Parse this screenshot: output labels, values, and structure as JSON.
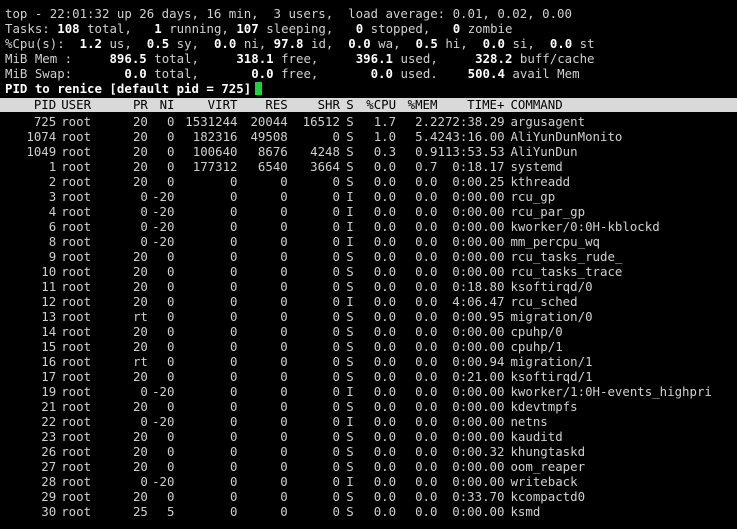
{
  "summary": {
    "line1": "top - 22:01:32 up 26 days, 16 min,  3 users,  load average: 0.01, 0.02, 0.00",
    "tasks": {
      "label": "Tasks:",
      "total": "108",
      "total_l": "total,",
      "running": "1",
      "running_l": "running,",
      "sleeping": "107",
      "sleeping_l": "sleeping,",
      "stopped": "0",
      "stopped_l": "stopped,",
      "zombie": "0",
      "zombie_l": "zombie"
    },
    "cpu": {
      "label": "%Cpu(s):",
      "us": "1.2",
      "us_l": "us,",
      "sy": "0.5",
      "sy_l": "sy,",
      "ni": "0.0",
      "ni_l": "ni,",
      "id": "97.8",
      "id_l": "id,",
      "wa": "0.0",
      "wa_l": "wa,",
      "hi": "0.5",
      "hi_l": "hi,",
      "si": "0.0",
      "si_l": "si,",
      "st": "0.0",
      "st_l": "st"
    },
    "mem": {
      "label": "MiB Mem :",
      "total": "896.5",
      "total_l": "total,",
      "free": "318.1",
      "free_l": "free,",
      "used": "396.1",
      "used_l": "used,",
      "buff": "328.2",
      "buff_l": "buff/cache"
    },
    "swap": {
      "label": "MiB Swap:",
      "total": "0.0",
      "total_l": "total,",
      "free": "0.0",
      "free_l": "free,",
      "used": "0.0",
      "used_l": "used.",
      "avail": "500.4",
      "avail_l": "avail Mem"
    }
  },
  "prompt": {
    "text": "PID to renice [default pid = 725]"
  },
  "columns": {
    "pid": "PID",
    "user": "USER",
    "pr": "PR",
    "ni": "NI",
    "virt": "VIRT",
    "res": "RES",
    "shr": "SHR",
    "s": "S",
    "cpu": "%CPU",
    "mem": "%MEM",
    "time": "TIME+",
    "command": "COMMAND"
  },
  "processes": [
    {
      "pid": "725",
      "user": "root",
      "pr": "20",
      "ni": "0",
      "virt": "1531244",
      "res": "20044",
      "shr": "16512",
      "s": "S",
      "cpu": "1.7",
      "mem": "2.2",
      "time": "272:38.29",
      "command": "argusagent"
    },
    {
      "pid": "1074",
      "user": "root",
      "pr": "20",
      "ni": "0",
      "virt": "182316",
      "res": "49508",
      "shr": "0",
      "s": "S",
      "cpu": "1.0",
      "mem": "5.4",
      "time": "243:16.00",
      "command": "AliYunDunMonito"
    },
    {
      "pid": "1049",
      "user": "root",
      "pr": "20",
      "ni": "0",
      "virt": "100640",
      "res": "8676",
      "shr": "4248",
      "s": "S",
      "cpu": "0.3",
      "mem": "0.9",
      "time": "113:53.53",
      "command": "AliYunDun"
    },
    {
      "pid": "1",
      "user": "root",
      "pr": "20",
      "ni": "0",
      "virt": "177312",
      "res": "6540",
      "shr": "3664",
      "s": "S",
      "cpu": "0.0",
      "mem": "0.7",
      "time": "0:18.17",
      "command": "systemd"
    },
    {
      "pid": "2",
      "user": "root",
      "pr": "20",
      "ni": "0",
      "virt": "0",
      "res": "0",
      "shr": "0",
      "s": "S",
      "cpu": "0.0",
      "mem": "0.0",
      "time": "0:00.25",
      "command": "kthreadd"
    },
    {
      "pid": "3",
      "user": "root",
      "pr": "0",
      "ni": "-20",
      "virt": "0",
      "res": "0",
      "shr": "0",
      "s": "I",
      "cpu": "0.0",
      "mem": "0.0",
      "time": "0:00.00",
      "command": "rcu_gp"
    },
    {
      "pid": "4",
      "user": "root",
      "pr": "0",
      "ni": "-20",
      "virt": "0",
      "res": "0",
      "shr": "0",
      "s": "I",
      "cpu": "0.0",
      "mem": "0.0",
      "time": "0:00.00",
      "command": "rcu_par_gp"
    },
    {
      "pid": "6",
      "user": "root",
      "pr": "0",
      "ni": "-20",
      "virt": "0",
      "res": "0",
      "shr": "0",
      "s": "I",
      "cpu": "0.0",
      "mem": "0.0",
      "time": "0:00.00",
      "command": "kworker/0:0H-kblockd"
    },
    {
      "pid": "8",
      "user": "root",
      "pr": "0",
      "ni": "-20",
      "virt": "0",
      "res": "0",
      "shr": "0",
      "s": "I",
      "cpu": "0.0",
      "mem": "0.0",
      "time": "0:00.00",
      "command": "mm_percpu_wq"
    },
    {
      "pid": "9",
      "user": "root",
      "pr": "20",
      "ni": "0",
      "virt": "0",
      "res": "0",
      "shr": "0",
      "s": "S",
      "cpu": "0.0",
      "mem": "0.0",
      "time": "0:00.00",
      "command": "rcu_tasks_rude_"
    },
    {
      "pid": "10",
      "user": "root",
      "pr": "20",
      "ni": "0",
      "virt": "0",
      "res": "0",
      "shr": "0",
      "s": "S",
      "cpu": "0.0",
      "mem": "0.0",
      "time": "0:00.00",
      "command": "rcu_tasks_trace"
    },
    {
      "pid": "11",
      "user": "root",
      "pr": "20",
      "ni": "0",
      "virt": "0",
      "res": "0",
      "shr": "0",
      "s": "S",
      "cpu": "0.0",
      "mem": "0.0",
      "time": "0:18.80",
      "command": "ksoftirqd/0"
    },
    {
      "pid": "12",
      "user": "root",
      "pr": "20",
      "ni": "0",
      "virt": "0",
      "res": "0",
      "shr": "0",
      "s": "I",
      "cpu": "0.0",
      "mem": "0.0",
      "time": "4:06.47",
      "command": "rcu_sched"
    },
    {
      "pid": "13",
      "user": "root",
      "pr": "rt",
      "ni": "0",
      "virt": "0",
      "res": "0",
      "shr": "0",
      "s": "S",
      "cpu": "0.0",
      "mem": "0.0",
      "time": "0:00.95",
      "command": "migration/0"
    },
    {
      "pid": "14",
      "user": "root",
      "pr": "20",
      "ni": "0",
      "virt": "0",
      "res": "0",
      "shr": "0",
      "s": "S",
      "cpu": "0.0",
      "mem": "0.0",
      "time": "0:00.00",
      "command": "cpuhp/0"
    },
    {
      "pid": "15",
      "user": "root",
      "pr": "20",
      "ni": "0",
      "virt": "0",
      "res": "0",
      "shr": "0",
      "s": "S",
      "cpu": "0.0",
      "mem": "0.0",
      "time": "0:00.00",
      "command": "cpuhp/1"
    },
    {
      "pid": "16",
      "user": "root",
      "pr": "rt",
      "ni": "0",
      "virt": "0",
      "res": "0",
      "shr": "0",
      "s": "S",
      "cpu": "0.0",
      "mem": "0.0",
      "time": "0:00.94",
      "command": "migration/1"
    },
    {
      "pid": "17",
      "user": "root",
      "pr": "20",
      "ni": "0",
      "virt": "0",
      "res": "0",
      "shr": "0",
      "s": "S",
      "cpu": "0.0",
      "mem": "0.0",
      "time": "0:21.00",
      "command": "ksoftirqd/1"
    },
    {
      "pid": "19",
      "user": "root",
      "pr": "0",
      "ni": "-20",
      "virt": "0",
      "res": "0",
      "shr": "0",
      "s": "I",
      "cpu": "0.0",
      "mem": "0.0",
      "time": "0:00.00",
      "command": "kworker/1:0H-events_highpri"
    },
    {
      "pid": "21",
      "user": "root",
      "pr": "20",
      "ni": "0",
      "virt": "0",
      "res": "0",
      "shr": "0",
      "s": "S",
      "cpu": "0.0",
      "mem": "0.0",
      "time": "0:00.00",
      "command": "kdevtmpfs"
    },
    {
      "pid": "22",
      "user": "root",
      "pr": "0",
      "ni": "-20",
      "virt": "0",
      "res": "0",
      "shr": "0",
      "s": "I",
      "cpu": "0.0",
      "mem": "0.0",
      "time": "0:00.00",
      "command": "netns"
    },
    {
      "pid": "23",
      "user": "root",
      "pr": "20",
      "ni": "0",
      "virt": "0",
      "res": "0",
      "shr": "0",
      "s": "S",
      "cpu": "0.0",
      "mem": "0.0",
      "time": "0:00.00",
      "command": "kauditd"
    },
    {
      "pid": "26",
      "user": "root",
      "pr": "20",
      "ni": "0",
      "virt": "0",
      "res": "0",
      "shr": "0",
      "s": "S",
      "cpu": "0.0",
      "mem": "0.0",
      "time": "0:00.32",
      "command": "khungtaskd"
    },
    {
      "pid": "27",
      "user": "root",
      "pr": "20",
      "ni": "0",
      "virt": "0",
      "res": "0",
      "shr": "0",
      "s": "S",
      "cpu": "0.0",
      "mem": "0.0",
      "time": "0:00.00",
      "command": "oom_reaper"
    },
    {
      "pid": "28",
      "user": "root",
      "pr": "0",
      "ni": "-20",
      "virt": "0",
      "res": "0",
      "shr": "0",
      "s": "I",
      "cpu": "0.0",
      "mem": "0.0",
      "time": "0:00.00",
      "command": "writeback"
    },
    {
      "pid": "29",
      "user": "root",
      "pr": "20",
      "ni": "0",
      "virt": "0",
      "res": "0",
      "shr": "0",
      "s": "S",
      "cpu": "0.0",
      "mem": "0.0",
      "time": "0:33.70",
      "command": "kcompactd0"
    },
    {
      "pid": "30",
      "user": "root",
      "pr": "25",
      "ni": "5",
      "virt": "0",
      "res": "0",
      "shr": "0",
      "s": "S",
      "cpu": "0.0",
      "mem": "0.0",
      "time": "0:00.00",
      "command": "ksmd"
    }
  ],
  "colors": {
    "background": "#000000",
    "text": "#d0d0d0",
    "header_bg": "#d9d9d9",
    "cursor": "#19d43a"
  }
}
